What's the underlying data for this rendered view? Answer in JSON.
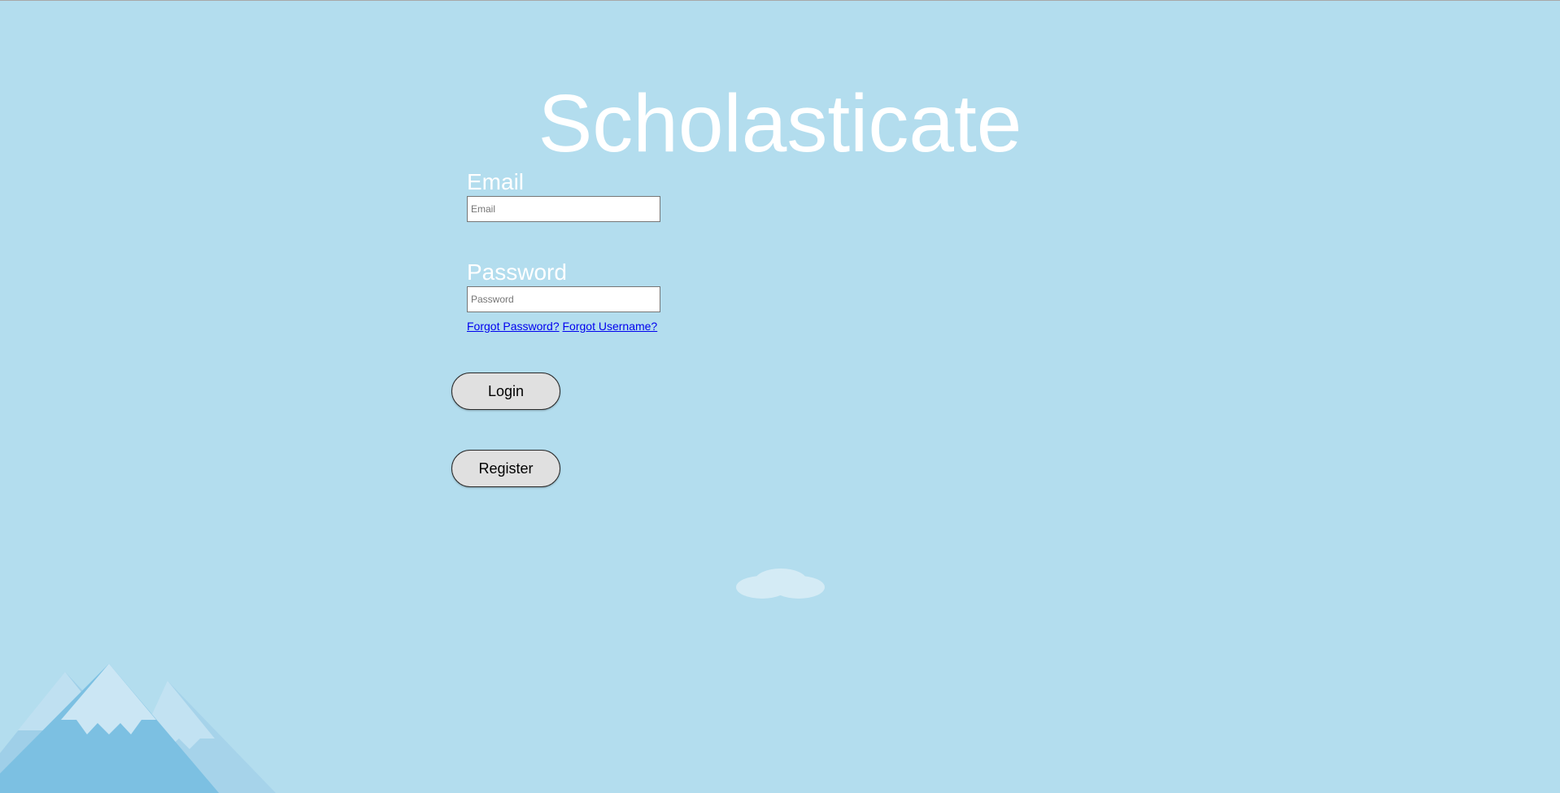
{
  "app": {
    "title": "Scholasticate"
  },
  "login_form": {
    "email": {
      "label": "Email",
      "placeholder": "Email",
      "value": ""
    },
    "password": {
      "label": "Password",
      "placeholder": "Password",
      "value": ""
    },
    "links": {
      "forgot_password": "Forgot Password?",
      "forgot_username": "Forgot Username?"
    },
    "login_label": "Login",
    "register_label": "Register"
  },
  "decorations": {
    "cloud": "cloud-icon",
    "mountains": "mountains-illustration"
  },
  "colors": {
    "background": "#b3ddee",
    "title_text": "#ffffff",
    "link": "#0000ee",
    "button_fill": "#e0e0e0"
  }
}
